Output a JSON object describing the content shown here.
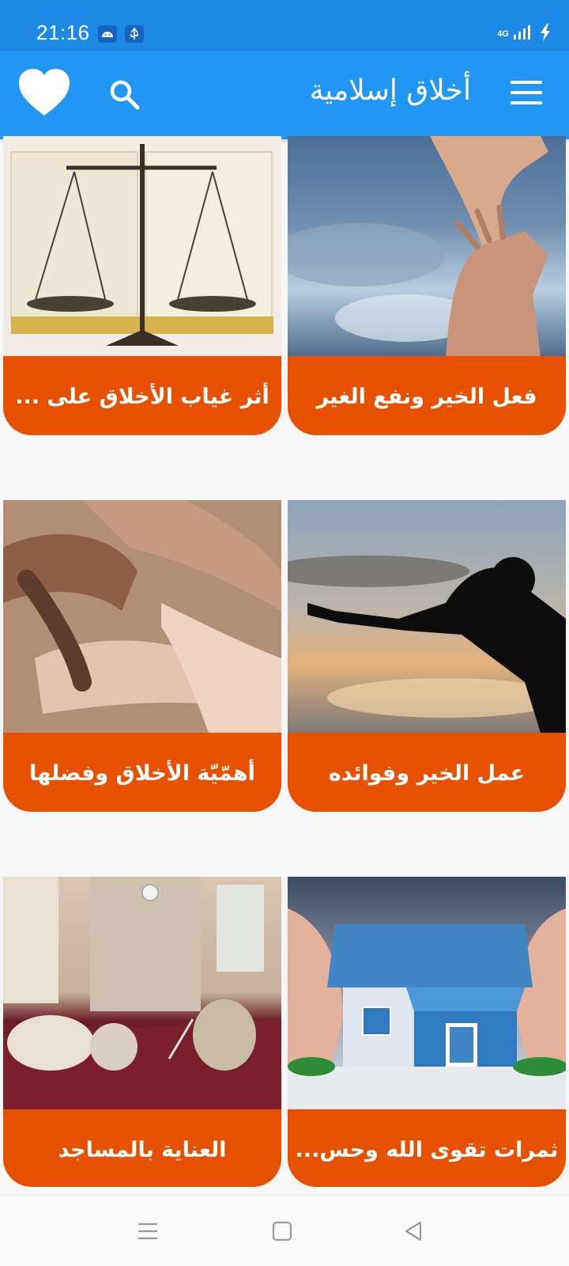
{
  "status_bar": {
    "time": "21:16",
    "network": "4G"
  },
  "app_bar": {
    "title": "أخلاق إسلامية"
  },
  "cards": [
    {
      "label": "فعل الخير ونفع الغير",
      "image": "reaching-hands-sky"
    },
    {
      "label": "أثر غياب الأخلاق على ...",
      "image": "scales-of-justice-quran"
    },
    {
      "label": "عمل الخير وفوائده",
      "image": "silhouette-reaching-sunset"
    },
    {
      "label": "أهمّيّة الأخلاق وفضلها",
      "image": "linked-hands"
    },
    {
      "label": "ثمرات تقوى الله وحس...",
      "image": "hands-around-house"
    },
    {
      "label": "العناية بالمساجد",
      "image": "mosque-cleaning"
    }
  ],
  "colors": {
    "status": "#1e88e5",
    "appbar": "#2196f3",
    "card": "#e65100",
    "background": "#f6f6f6"
  }
}
